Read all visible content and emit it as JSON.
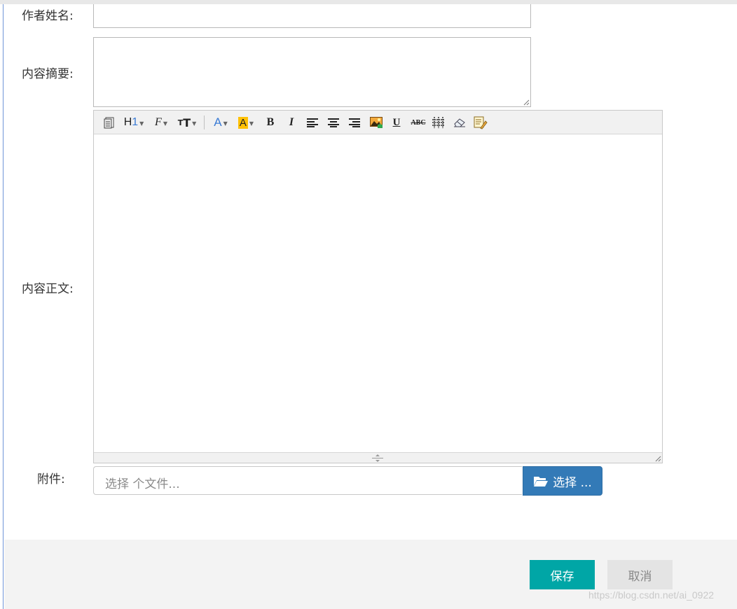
{
  "form": {
    "author_label": "作者姓名:",
    "summary_label": "内容摘要:",
    "body_label": "内容正文:",
    "attachment_label": "附件:"
  },
  "editor": {
    "toolbar": [
      {
        "id": "source",
        "icon": "source-icon",
        "label": ""
      },
      {
        "id": "heading",
        "icon": "heading-icon",
        "label": "H1"
      },
      {
        "id": "font-family",
        "icon": "font-family-icon",
        "label": "F"
      },
      {
        "id": "font-size",
        "icon": "font-size-icon",
        "label": "T"
      },
      {
        "id": "font-color",
        "icon": "font-color-icon",
        "label": "A"
      },
      {
        "id": "bg-color",
        "icon": "background-color-icon",
        "label": "A"
      },
      {
        "id": "bold",
        "icon": "bold-icon",
        "label": "B"
      },
      {
        "id": "italic",
        "icon": "italic-icon",
        "label": "I"
      },
      {
        "id": "align-left",
        "icon": "align-left-icon",
        "label": ""
      },
      {
        "id": "align-center",
        "icon": "align-center-icon",
        "label": ""
      },
      {
        "id": "align-right",
        "icon": "align-right-icon",
        "label": ""
      },
      {
        "id": "image",
        "icon": "image-icon",
        "label": ""
      },
      {
        "id": "underline",
        "icon": "underline-icon",
        "label": "U"
      },
      {
        "id": "strikethrough",
        "icon": "strikethrough-icon",
        "label": "ABC"
      },
      {
        "id": "table",
        "icon": "table-icon",
        "label": ""
      },
      {
        "id": "eraser",
        "icon": "eraser-icon",
        "label": ""
      },
      {
        "id": "clear-format",
        "icon": "clear-format-icon",
        "label": ""
      }
    ]
  },
  "file": {
    "placeholder": "选择 个文件...",
    "button_label": "选择 ..."
  },
  "actions": {
    "save": "保存",
    "cancel": "取消"
  },
  "watermark": "https://blog.csdn.net/ai_0922",
  "colors": {
    "accent": "#00a6a6",
    "file_button": "#337ab7",
    "cancel_bg": "#e4e4e4"
  }
}
